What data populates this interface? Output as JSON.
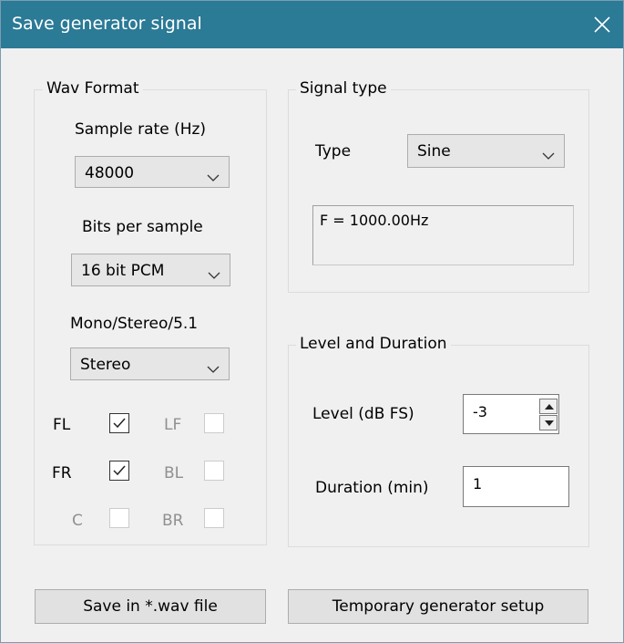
{
  "window": {
    "title": "Save generator signal"
  },
  "wav_format": {
    "legend": "Wav Format",
    "sample_rate_label": "Sample rate (Hz)",
    "sample_rate_value": "48000",
    "bits_label": "Bits per sample",
    "bits_value": "16 bit PCM",
    "channels_label": "Mono/Stereo/5.1",
    "channels_value": "Stereo",
    "speakers": {
      "fl": {
        "label": "FL",
        "checked": true,
        "enabled": true
      },
      "lf": {
        "label": "LF",
        "checked": false,
        "enabled": false
      },
      "fr": {
        "label": "FR",
        "checked": true,
        "enabled": true
      },
      "bl": {
        "label": "BL",
        "checked": false,
        "enabled": false
      },
      "c": {
        "label": "C",
        "checked": false,
        "enabled": false
      },
      "br": {
        "label": "BR",
        "checked": false,
        "enabled": false
      }
    }
  },
  "signal_type": {
    "legend": "Signal type",
    "type_label": "Type",
    "type_value": "Sine",
    "info": "F = 1000.00Hz"
  },
  "level_duration": {
    "legend": "Level and Duration",
    "level_label": "Level (dB FS)",
    "level_value": "-3",
    "duration_label": "Duration (min)",
    "duration_value": "1"
  },
  "buttons": {
    "save": "Save in *.wav file",
    "temp_setup": "Temporary generator setup"
  }
}
